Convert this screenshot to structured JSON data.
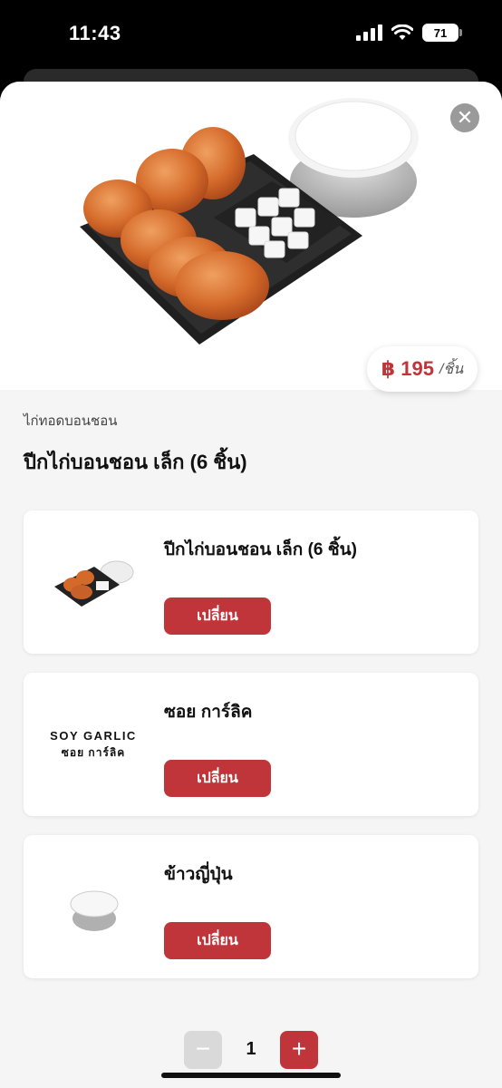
{
  "status": {
    "time": "11:43",
    "battery": "71"
  },
  "product": {
    "category": "ไก่ทอดบอนชอน",
    "title": "ปีกไก่บอนชอน เล็ก (6 ชิ้น)",
    "price": "฿ 195",
    "price_unit": "/ชิ้น"
  },
  "options": [
    {
      "name": "ปีกไก่บอนชอน เล็ก (6 ชิ้น)",
      "button": "เปลี่ยน"
    },
    {
      "name": "ซอย การ์ลิค",
      "logo_en": "SOY GARLIC",
      "logo_th": "ซอย การ์ลิค",
      "button": "เปลี่ยน"
    },
    {
      "name": "ข้าวญี่ปุ่น",
      "button": "เปลี่ยน"
    }
  ],
  "quantity": {
    "minus": "−",
    "value": "1",
    "plus": "+"
  },
  "icons": {
    "close": "close-icon",
    "wifi": "wifi-icon",
    "signal": "signal-icon",
    "battery": "battery-icon"
  },
  "colors": {
    "accent": "#c0353a",
    "disabled": "#d9d9d9"
  }
}
